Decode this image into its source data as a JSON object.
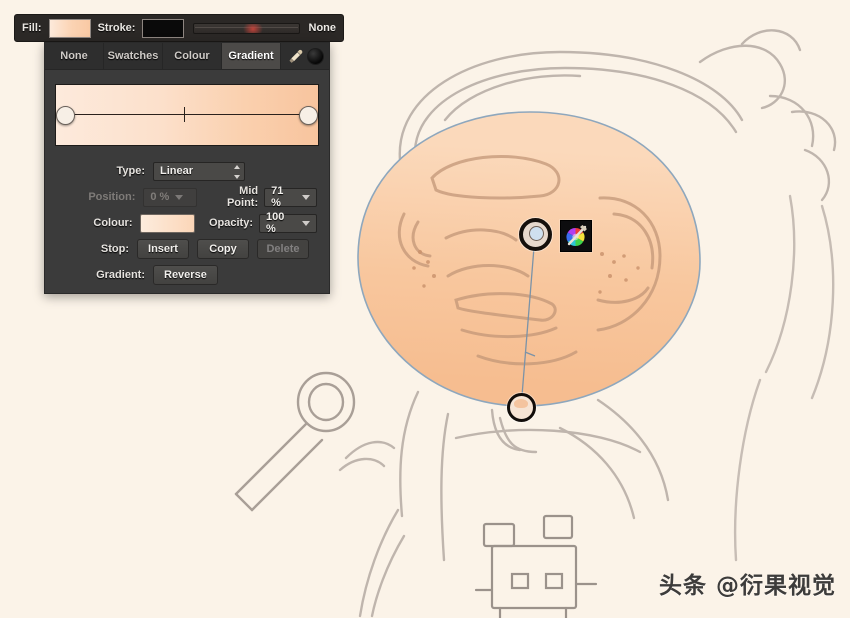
{
  "app": {
    "background_color": "#fbf3e8",
    "panel_bg": "#3b3b3b",
    "accent_fill": "#fbd3b3"
  },
  "topbar": {
    "fill_label": "Fill:",
    "fill_swatch_name": "fill-swatch",
    "stroke_label": "Stroke:",
    "stroke_swatch_color": "#0a0a0a",
    "stroke_width_value": "None"
  },
  "panel": {
    "tabs": [
      {
        "label": "None",
        "selected": false
      },
      {
        "label": "Swatches",
        "selected": false
      },
      {
        "label": "Colour",
        "selected": false
      },
      {
        "label": "Gradient",
        "selected": true
      }
    ],
    "tools": {
      "eyedropper": "eyedropper-icon",
      "swatch": "current-colour-dot"
    },
    "gradient_preview": {
      "start_color": "#fdeadc",
      "end_color": "#f8c49e",
      "mid_point_position_pct": 71
    },
    "fields": {
      "type_label": "Type:",
      "type_value": "Linear",
      "position_label": "Position:",
      "position_value": "0 %",
      "position_disabled": true,
      "midpoint_label": "Mid Point:",
      "midpoint_value": "71 %",
      "colour_label": "Colour:",
      "opacity_label": "Opacity:",
      "opacity_value": "100 %",
      "stop_label": "Stop:",
      "stop_insert": "Insert",
      "stop_copy": "Copy",
      "stop_delete": "Delete",
      "stop_delete_disabled": true,
      "gradient_label": "Gradient:",
      "gradient_reverse": "Reverse"
    }
  },
  "canvas": {
    "gradient_handles": {
      "start_name": "gradient-start-handle",
      "end_name": "gradient-end-handle"
    },
    "colour_wheel_button": "colour-wheel-button",
    "watermark": "头条 @衍果视觉"
  }
}
